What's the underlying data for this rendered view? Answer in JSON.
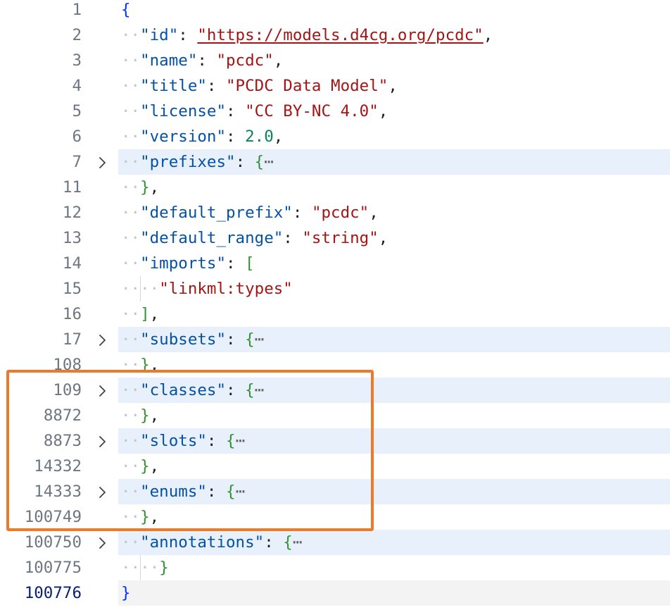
{
  "editor": {
    "language": "json",
    "colors": {
      "key": "#0451a5",
      "string": "#a31515",
      "number": "#098658",
      "brace_level1": "#0431fa",
      "brace_level2": "#319331",
      "fold_highlight": "#e8f0fc",
      "callout": "#ec7a2a"
    },
    "lines": [
      {
        "num": "1",
        "indent": 0,
        "tokens": [
          {
            "t": "{",
            "c": "b1"
          }
        ]
      },
      {
        "num": "2",
        "indent": 1,
        "tokens": [
          {
            "t": "\"id\"",
            "c": "k"
          },
          {
            "t": ": ",
            "c": "p"
          },
          {
            "t": "\"https://models.d4cg.org/pcdc\"",
            "c": "s link"
          },
          {
            "t": ",",
            "c": "p"
          }
        ]
      },
      {
        "num": "3",
        "indent": 1,
        "tokens": [
          {
            "t": "\"name\"",
            "c": "k"
          },
          {
            "t": ": ",
            "c": "p"
          },
          {
            "t": "\"pcdc\"",
            "c": "s"
          },
          {
            "t": ",",
            "c": "p"
          }
        ]
      },
      {
        "num": "4",
        "indent": 1,
        "tokens": [
          {
            "t": "\"title\"",
            "c": "k"
          },
          {
            "t": ": ",
            "c": "p"
          },
          {
            "t": "\"PCDC Data Model\"",
            "c": "s"
          },
          {
            "t": ",",
            "c": "p"
          }
        ]
      },
      {
        "num": "5",
        "indent": 1,
        "tokens": [
          {
            "t": "\"license\"",
            "c": "k"
          },
          {
            "t": ": ",
            "c": "p"
          },
          {
            "t": "\"CC BY-NC 4.0\"",
            "c": "s"
          },
          {
            "t": ",",
            "c": "p"
          }
        ]
      },
      {
        "num": "6",
        "indent": 1,
        "tokens": [
          {
            "t": "\"version\"",
            "c": "k"
          },
          {
            "t": ": ",
            "c": "p"
          },
          {
            "t": "2.0",
            "c": "n"
          },
          {
            "t": ",",
            "c": "p"
          }
        ]
      },
      {
        "num": "7",
        "indent": 1,
        "fold": true,
        "tokens": [
          {
            "t": "\"prefixes\"",
            "c": "k"
          },
          {
            "t": ": ",
            "c": "p"
          },
          {
            "t": "{",
            "c": "b2"
          },
          {
            "t": "⋯",
            "c": "ell"
          }
        ]
      },
      {
        "num": "11",
        "indent": 1,
        "tokens": [
          {
            "t": "}",
            "c": "b2"
          },
          {
            "t": ",",
            "c": "p"
          }
        ]
      },
      {
        "num": "12",
        "indent": 1,
        "tokens": [
          {
            "t": "\"default_prefix\"",
            "c": "k"
          },
          {
            "t": ": ",
            "c": "p"
          },
          {
            "t": "\"pcdc\"",
            "c": "s"
          },
          {
            "t": ",",
            "c": "p"
          }
        ]
      },
      {
        "num": "13",
        "indent": 1,
        "tokens": [
          {
            "t": "\"default_range\"",
            "c": "k"
          },
          {
            "t": ": ",
            "c": "p"
          },
          {
            "t": "\"string\"",
            "c": "s"
          },
          {
            "t": ",",
            "c": "p"
          }
        ]
      },
      {
        "num": "14",
        "indent": 1,
        "tokens": [
          {
            "t": "\"imports\"",
            "c": "k"
          },
          {
            "t": ": ",
            "c": "p"
          },
          {
            "t": "[",
            "c": "b2"
          }
        ]
      },
      {
        "num": "15",
        "indent": 2,
        "tokens": [
          {
            "t": "\"linkml:types\"",
            "c": "s"
          }
        ]
      },
      {
        "num": "16",
        "indent": 1,
        "tokens": [
          {
            "t": "]",
            "c": "b2"
          },
          {
            "t": ",",
            "c": "p"
          }
        ]
      },
      {
        "num": "17",
        "indent": 1,
        "fold": true,
        "tokens": [
          {
            "t": "\"subsets\"",
            "c": "k"
          },
          {
            "t": ": ",
            "c": "p"
          },
          {
            "t": "{",
            "c": "b2"
          },
          {
            "t": "⋯",
            "c": "ell"
          }
        ]
      },
      {
        "num": "108",
        "indent": 1,
        "tokens": [
          {
            "t": "}",
            "c": "b2"
          },
          {
            "t": ",",
            "c": "p"
          }
        ]
      },
      {
        "num": "109",
        "indent": 1,
        "fold": true,
        "tokens": [
          {
            "t": "\"classes\"",
            "c": "k"
          },
          {
            "t": ": ",
            "c": "p"
          },
          {
            "t": "{",
            "c": "b2"
          },
          {
            "t": "⋯",
            "c": "ell"
          }
        ]
      },
      {
        "num": "8872",
        "indent": 1,
        "tokens": [
          {
            "t": "}",
            "c": "b2"
          },
          {
            "t": ",",
            "c": "p"
          }
        ]
      },
      {
        "num": "8873",
        "indent": 1,
        "fold": true,
        "tokens": [
          {
            "t": "\"slots\"",
            "c": "k"
          },
          {
            "t": ": ",
            "c": "p"
          },
          {
            "t": "{",
            "c": "b2"
          },
          {
            "t": "⋯",
            "c": "ell"
          }
        ]
      },
      {
        "num": "14332",
        "indent": 1,
        "tokens": [
          {
            "t": "}",
            "c": "b2"
          },
          {
            "t": ",",
            "c": "p"
          }
        ]
      },
      {
        "num": "14333",
        "indent": 1,
        "fold": true,
        "tokens": [
          {
            "t": "\"enums\"",
            "c": "k"
          },
          {
            "t": ": ",
            "c": "p"
          },
          {
            "t": "{",
            "c": "b2"
          },
          {
            "t": "⋯",
            "c": "ell"
          }
        ]
      },
      {
        "num": "100749",
        "indent": 1,
        "tokens": [
          {
            "t": "}",
            "c": "b2"
          },
          {
            "t": ",",
            "c": "p"
          }
        ]
      },
      {
        "num": "100750",
        "indent": 1,
        "fold": true,
        "tokens": [
          {
            "t": "\"annotations\"",
            "c": "k"
          },
          {
            "t": ": ",
            "c": "p"
          },
          {
            "t": "{",
            "c": "b2"
          },
          {
            "t": "⋯",
            "c": "ell"
          }
        ]
      },
      {
        "num": "100775",
        "indent": 2,
        "tokens": [
          {
            "t": "}",
            "c": "b2"
          }
        ]
      },
      {
        "num": "100776",
        "indent": 0,
        "current": true,
        "tokens": [
          {
            "t": "}",
            "c": "b1"
          }
        ]
      }
    ]
  }
}
